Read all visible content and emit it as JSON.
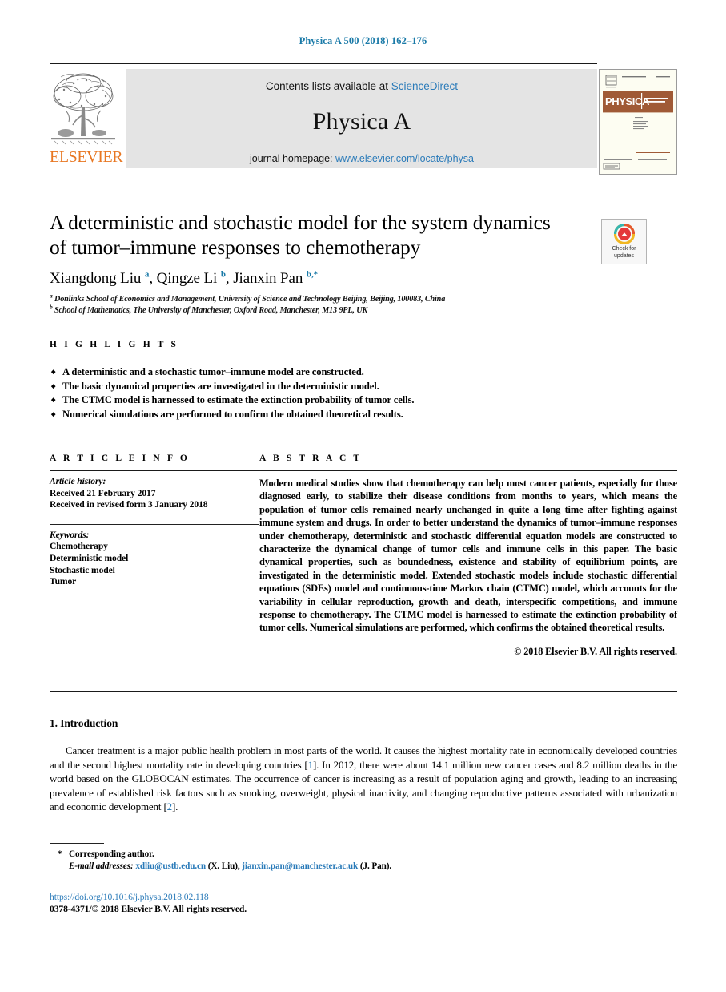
{
  "running_head": "Physica A 500 (2018) 162–176",
  "masthead": {
    "contents_prefix": "Contents lists available at",
    "contents_link": "ScienceDirect",
    "journal_name": "Physica A",
    "homepage_prefix": "journal homepage:",
    "homepage_link": "www.elsevier.com/locate/physa",
    "publisher_logo_text": "ELSEVIER",
    "cover_title": "PHYSICA",
    "cover_subtitle": "STATISTICAL MECHANICS AND ITS APPLICATIONS"
  },
  "article": {
    "title": "A deterministic and stochastic model for the system dynamics of tumor–immune responses to chemotherapy",
    "authors_html": "Xiangdong Liu <sup>a</sup>, Qingze Li <sup>b</sup>, Jianxin Pan <sup>b,*</sup>",
    "affiliations": [
      {
        "marker": "a",
        "text": "Donlinks School of Economics and Management, University of Science and Technology Beijing, Beijing, 100083, China"
      },
      {
        "marker": "b",
        "text": "School of Mathematics, The University of Manchester, Oxford Road, Manchester, M13 9PL, UK"
      }
    ],
    "crossmark_label": "Check for updates"
  },
  "highlights": {
    "label": "H I G H L I G H T S",
    "items": [
      "A deterministic and a stochastic tumor–immune model are constructed.",
      "The basic dynamical properties are investigated in the deterministic model.",
      "The CTMC model is harnessed to estimate the extinction probability of tumor cells.",
      "Numerical simulations are performed to confirm the obtained theoretical results."
    ]
  },
  "article_info": {
    "label": "A R T I C L E    I N F O",
    "history_label": "Article history:",
    "history_lines": [
      "Received 21 February 2017",
      "Received in revised form 3 January 2018"
    ],
    "keywords_label": "Keywords:",
    "keywords": [
      "Chemotherapy",
      "Deterministic model",
      "Stochastic model",
      "Tumor"
    ]
  },
  "abstract": {
    "label": "A B S T R A C T",
    "text": "Modern medical studies show that chemotherapy can help most cancer patients, especially for those diagnosed early, to stabilize their disease conditions from months to years, which means the population of tumor cells remained nearly unchanged in quite a long time after fighting against immune system and drugs. In order to better understand the dynamics of tumor–immune responses under chemotherapy, deterministic and stochastic differential equation models are constructed to characterize the dynamical change of tumor cells and immune cells in this paper. The basic dynamical properties, such as boundedness, existence and stability of equilibrium points, are investigated in the deterministic model. Extended stochastic models include stochastic differential equations (SDEs) model and continuous-time Markov chain (CTMC) model, which accounts for the variability in cellular reproduction, growth and death, interspecific competitions, and immune response to chemotherapy. The CTMC model is harnessed to estimate the extinction probability of tumor cells. Numerical simulations are performed, which confirms the obtained theoretical results.",
    "copyright": "© 2018 Elsevier B.V. All rights reserved."
  },
  "introduction": {
    "heading": "1.  Introduction",
    "paragraph_parts": [
      "Cancer treatment is a major public health problem in most parts of the world. It causes the highest mortality rate in economically developed countries and the second highest mortality rate in developing countries [",
      "1",
      "]. In 2012, there were about 14.1 million new cancer cases and 8.2 million deaths in the world based on the GLOBOCAN estimates. The occurrence of cancer is increasing as a result of population aging and growth, leading to an increasing prevalence of established risk factors such as smoking, overweight, physical inactivity, and changing reproductive patterns associated with urbanization and economic development [",
      "2",
      "]."
    ]
  },
  "footnotes": {
    "corresponding_marker": "*",
    "corresponding_text": "Corresponding author.",
    "email_label": "E-mail addresses:",
    "email_1": "xdliu@ustb.edu.cn",
    "email_1_owner": "(X. Liu),",
    "email_2": "jianxin.pan@manchester.ac.uk",
    "email_2_owner": "(J. Pan)."
  },
  "doi": {
    "url": "https://doi.org/10.1016/j.physa.2018.02.118",
    "issn_line": "0378-4371/© 2018 Elsevier B.V. All rights reserved."
  },
  "colors": {
    "link": "#2b7bb9",
    "running_head": "#1a7aa8",
    "elsevier_orange": "#e87722",
    "masthead_bg": "#e4e4e4"
  }
}
